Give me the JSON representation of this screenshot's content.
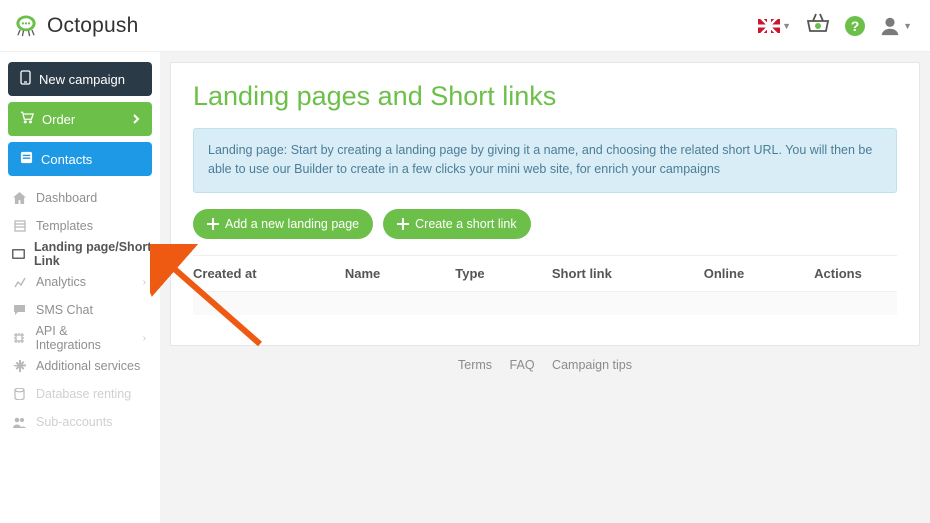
{
  "header": {
    "brand": "Octopush"
  },
  "sidebar": {
    "primary": {
      "new_campaign": "New campaign",
      "order": "Order",
      "contacts": "Contacts"
    },
    "menu": {
      "dashboard": "Dashboard",
      "templates": "Templates",
      "landing": "Landing page/Short Link",
      "analytics": "Analytics",
      "sms_chat": "SMS Chat",
      "api": "API & Integrations",
      "additional": "Additional services",
      "database": "Database renting",
      "sub_accounts": "Sub-accounts"
    }
  },
  "page": {
    "title": "Landing pages and Short links",
    "info": "Landing page: Start by creating a landing page by giving it a name, and choosing the related short URL. You will then be able to use our Builder to create in a few clicks your mini web site, for enrich your campaigns",
    "btn_add_landing": "Add a new landing page",
    "btn_create_short": "Create a short link",
    "columns": {
      "created_at": "Created at",
      "name": "Name",
      "type": "Type",
      "short_link": "Short link",
      "online": "Online",
      "actions": "Actions"
    }
  },
  "footer": {
    "terms": "Terms",
    "faq": "FAQ",
    "tips": "Campaign tips"
  }
}
